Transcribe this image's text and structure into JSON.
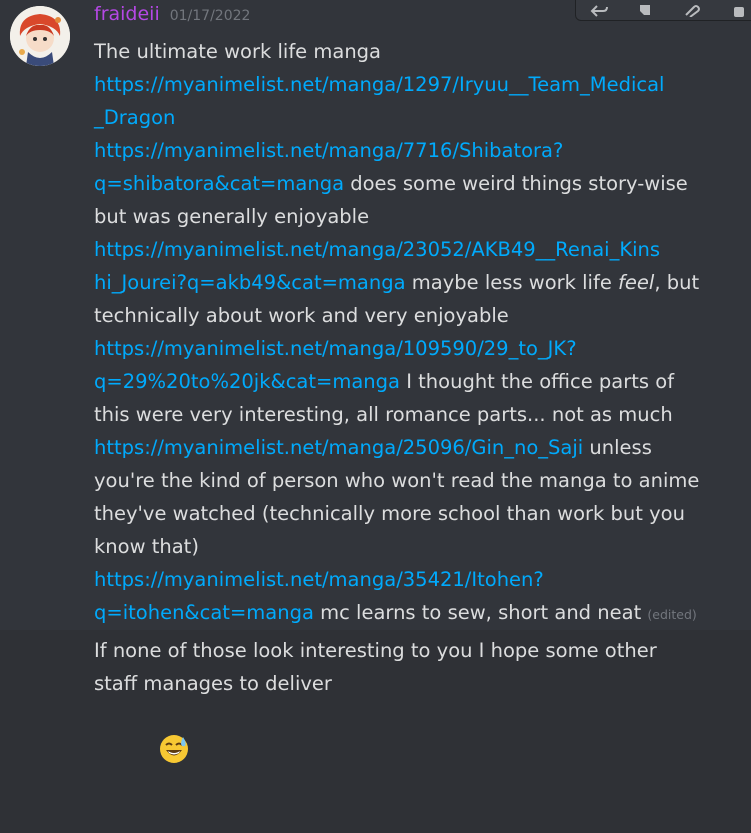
{
  "message": {
    "username": "fraideii",
    "timestamp": "01/17/2022",
    "user_color": "#b548e5",
    "link_color": "#00aafc",
    "lines": {
      "l0": "The ultimate work life manga",
      "l1": "https://myanimelist.net/manga/1297/Iryuu__Team_Medical",
      "l2": "_Dragon",
      "l3": "https://myanimelist.net/manga/7716/Shibatora?",
      "l4a": "q=shibatora&cat=manga",
      "l4b": " does some weird things story-wise",
      "l5": "but was generally enjoyable",
      "l6": "https://myanimelist.net/manga/23052/AKB49__Renai_Kins",
      "l7a": "hi_Jourei?q=akb49&cat=manga",
      "l7b": " maybe less work life ",
      "l7c": "feel",
      "l7d": ", but",
      "l8": "technically about work and very enjoyable",
      "l9": "https://myanimelist.net/manga/109590/29_to_JK?",
      "l10a": "q=29%20to%20jk&cat=manga",
      "l10b": " I thought the office parts of",
      "l11": "this were very interesting, all romance parts... not as much",
      "l12a": "https://myanimelist.net/manga/25096/Gin_no_Saji",
      "l12b": " unless",
      "l13": "you're the kind of person who won't read the manga to anime",
      "l14": "they've watched (technically more school than work but you",
      "l15": "know that)",
      "l16": "https://myanimelist.net/manga/35421/Itohen?",
      "l17a": "q=itohen&cat=manga",
      "l17b": " mc learns to sew, short and neat ",
      "edited": "(edited)"
    }
  },
  "second_message": {
    "line1": "If none of those look interesting to you I hope some other",
    "line2": "staff manages to deliver",
    "emoji": "sweat-smile-emoji"
  },
  "toolbar_icons": [
    "reply-icon",
    "react-icon",
    "edit-icon",
    "more-icon"
  ]
}
